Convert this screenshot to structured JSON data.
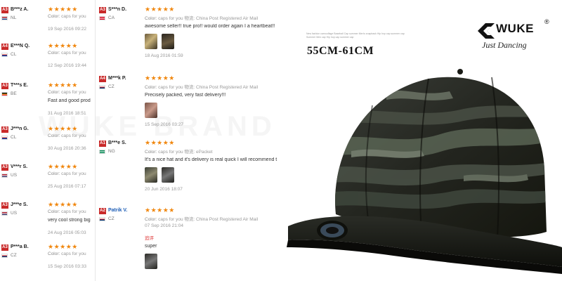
{
  "reviews_left": [
    {
      "badge": "A3",
      "user": "B***z A.",
      "country": "NL",
      "stars": "★★★★★",
      "color_label": "Color:",
      "color_value": "caps for you",
      "date": "19 Sep 2016 09:22",
      "flag": [
        "#ae1c28",
        "#ffffff",
        "#21468b"
      ]
    },
    {
      "badge": "A4",
      "user": "E***N Q.",
      "country": "CL",
      "stars": "★★★★★",
      "color_label": "Color:",
      "color_value": "caps for you",
      "date": "12 Sep 2016 19:44",
      "flag": [
        "#ffffff",
        "#d52b1e",
        "#0039a6"
      ]
    },
    {
      "badge": "A3",
      "user": "T***s E.",
      "country": "BE",
      "stars": "★★★★★",
      "color_label": "Color:",
      "color_value": "caps for you",
      "text": "Fast and good prod",
      "date": "31 Aug 2016 18:51",
      "flag": [
        "#000000",
        "#fdda24",
        "#ef3340"
      ]
    },
    {
      "badge": "A3",
      "user": "J***n G.",
      "country": "CL",
      "stars": "★★★★★",
      "color_label": "Color:",
      "color_value": "caps for you",
      "date": "30 Aug 2016 20:36",
      "flag": [
        "#ffffff",
        "#d52b1e",
        "#0039a6"
      ]
    },
    {
      "badge": "A3",
      "user": "V***r S.",
      "country": "US",
      "stars": "★★★★★",
      "color_label": "Color:",
      "color_value": "caps for you",
      "date": "25 Aug 2016 07:17",
      "flag": [
        "#b22234",
        "#ffffff",
        "#3c3b6e"
      ]
    },
    {
      "badge": "A3",
      "user": "J***e S.",
      "country": "US",
      "stars": "★★★★★",
      "color_label": "Color:",
      "color_value": "caps for you",
      "text": "very cool strong big",
      "date": "24 Aug 2016 05:03",
      "flag": [
        "#b22234",
        "#ffffff",
        "#3c3b6e"
      ]
    },
    {
      "badge": "A3",
      "user": "P***a B.",
      "country": "CZ",
      "stars": "★★★★★",
      "color_label": "Color:",
      "color_value": "caps for you",
      "date": "15 Sep 2016 03:33",
      "flag": [
        "#ffffff",
        "#d7141a",
        "#11457e"
      ]
    }
  ],
  "reviews_right": [
    {
      "badge": "A3",
      "user": "S***n D.",
      "country": "CA",
      "stars": "★★★★★",
      "color_label": "Color:",
      "color_value": "caps for you",
      "shipping": "物流: China Post Registered Air Mail",
      "text": "awesome seller!! true pro!! would order again I a heartbeat!!",
      "date": "18 Aug 2016 01:59",
      "flag": [
        "#d80621",
        "#ffffff",
        "#d80621"
      ],
      "thumbs": [
        "t1",
        "t2"
      ]
    },
    {
      "badge": "A4",
      "user": "M***k P.",
      "country": "CZ",
      "stars": "★★★★★",
      "color_label": "Color:",
      "color_value": "caps for you",
      "shipping": "物流: China Post Registered Air Mail",
      "text": "Precisely packed, very fast delivery!!!",
      "date": "15 Sep 2016 03:27",
      "flag": [
        "#ffffff",
        "#d7141a",
        "#11457e"
      ],
      "thumbs": [
        "t3"
      ]
    },
    {
      "badge": "A1",
      "user": "B***e S.",
      "country": "NG",
      "stars": "★★★★★",
      "color_label": "Color:",
      "color_value": "caps for you",
      "shipping": "物流: ePacket",
      "text": "It's a nice hat and it's delivery is real quick I will recommend t",
      "date": "20 Jun 2016 18:07",
      "flag": [
        "#008751",
        "#ffffff",
        "#008751"
      ],
      "thumbs": [
        "t4",
        "t5"
      ]
    },
    {
      "badge": "A2",
      "user": "Patrik V.",
      "country": "CZ",
      "stars": "★★★★★",
      "color_label": "Color:",
      "color_value": "caps for you",
      "shipping": "物流: China Post Registered Air Mail",
      "date": "07 Sep 2016 21:04",
      "followup_label": "追评",
      "text": "super",
      "flag": [
        "#ffffff",
        "#d7141a",
        "#11457e"
      ],
      "thumbs": [
        "t5"
      ],
      "link_user": true
    }
  ],
  "watermark": "WUKE BRAND",
  "product": {
    "tiny_text": "New fashion camouflage Baseball Cap summer Men's snapback Hip hop cap summer cap Summer Men cap Hip hop cap summer cap",
    "size_label": "55CM-61CM",
    "brand": "WUKE",
    "reg_mark": "®",
    "tagline": "Just Dancing",
    "cap_icon": "camouflage-snapback-cap"
  }
}
